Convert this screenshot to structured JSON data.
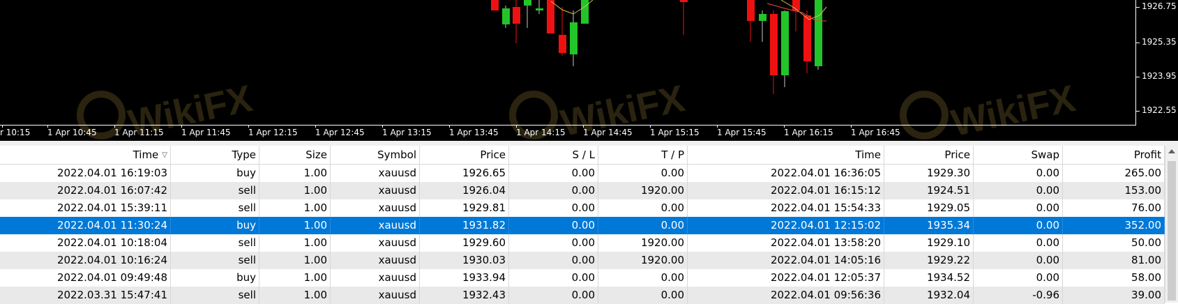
{
  "chart": {
    "price_labels": [
      "1926.75",
      "1925.35",
      "1923.95",
      "1922.55"
    ],
    "time_labels": [
      "r 10:15",
      "1 Apr 10:45",
      "1 Apr 11:15",
      "1 Apr 11:45",
      "1 Apr 12:15",
      "1 Apr 12:45",
      "1 Apr 13:15",
      "1 Apr 13:45",
      "1 Apr 14:15",
      "1 Apr 14:45",
      "1 Apr 15:15",
      "1 Apr 15:45",
      "1 Apr 16:15",
      "1 Apr 16:45"
    ],
    "watermark": "WikiFX",
    "colors": {
      "bull": "#22c42a",
      "bear": "#ee1111",
      "background": "#000000",
      "axis": "#ffffff"
    }
  },
  "table": {
    "columns": [
      "Time",
      "Type",
      "Size",
      "Symbol",
      "Price",
      "S / L",
      "T / P",
      "Time",
      "Price",
      "Swap",
      "Profit"
    ],
    "sort_icon": "sort-down-icon",
    "rows": [
      [
        "2022.04.01 16:19:03",
        "buy",
        "1.00",
        "xauusd",
        "1926.65",
        "0.00",
        "0.00",
        "2022.04.01 16:36:05",
        "1929.30",
        "0.00",
        "265.00"
      ],
      [
        "2022.04.01 16:07:42",
        "sell",
        "1.00",
        "xauusd",
        "1926.04",
        "0.00",
        "1920.00",
        "2022.04.01 16:15:12",
        "1924.51",
        "0.00",
        "153.00"
      ],
      [
        "2022.04.01 15:39:11",
        "sell",
        "1.00",
        "xauusd",
        "1929.81",
        "0.00",
        "0.00",
        "2022.04.01 15:54:33",
        "1929.05",
        "0.00",
        "76.00"
      ],
      [
        "2022.04.01 11:30:24",
        "buy",
        "1.00",
        "xauusd",
        "1931.82",
        "0.00",
        "0.00",
        "2022.04.01 12:15:02",
        "1935.34",
        "0.00",
        "352.00"
      ],
      [
        "2022.04.01 10:18:04",
        "sell",
        "1.00",
        "xauusd",
        "1929.60",
        "0.00",
        "1920.00",
        "2022.04.01 13:58:20",
        "1929.10",
        "0.00",
        "50.00"
      ],
      [
        "2022.04.01 10:16:24",
        "sell",
        "1.00",
        "xauusd",
        "1930.03",
        "0.00",
        "1920.00",
        "2022.04.01 14:05:16",
        "1929.22",
        "0.00",
        "81.00"
      ],
      [
        "2022.04.01 09:49:48",
        "buy",
        "1.00",
        "xauusd",
        "1933.94",
        "0.00",
        "0.00",
        "2022.04.01 12:05:37",
        "1934.52",
        "0.00",
        "58.00"
      ],
      [
        "2022.03.31 15:47:41",
        "sell",
        "1.00",
        "xauusd",
        "1932.43",
        "0.00",
        "0.00",
        "2022.04.01 09:56:36",
        "1932.04",
        "-0.96",
        "39.00"
      ]
    ],
    "selected_row": 3,
    "selection_color": "#0078d7"
  }
}
